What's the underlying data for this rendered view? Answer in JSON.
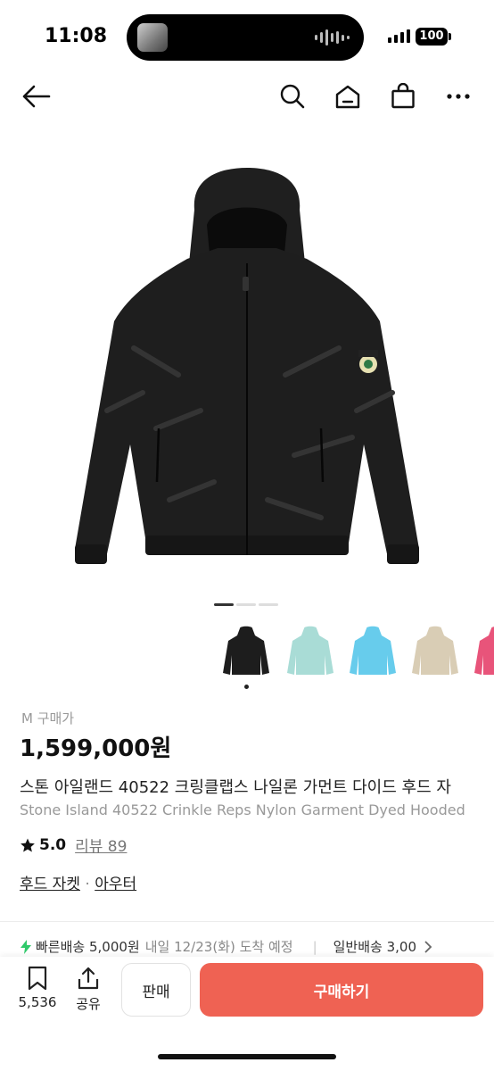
{
  "status_bar": {
    "time": "11:08",
    "battery": "100"
  },
  "product": {
    "size_label": "M 구매가",
    "price": "1,599,000원",
    "title_ko": "스톤 아일랜드 40522 크링클랩스 나일론 가먼트 다이드 후드 자",
    "title_en": "Stone Island 40522 Crinkle Reps Nylon Garment Dyed Hooded",
    "rating": "5.0",
    "review_label": "리뷰 89",
    "categories": [
      "후드 자켓",
      "아우터"
    ],
    "category_sep": "·"
  },
  "colors": {
    "black": "#1d1d1d",
    "mint": "#a9dcd6",
    "sky": "#67ccec",
    "beige": "#d9cdb5",
    "pink": "#e8547a",
    "accent": "#ef6253"
  },
  "shipping": {
    "fast_label": "빠른배송 5,000원",
    "fast_eta": "내일 12/23(화) 도착 예정",
    "normal_label": "일반배송 3,00"
  },
  "bottom_bar": {
    "bookmark_count": "5,536",
    "share_label": "공유",
    "sell_label": "판매",
    "buy_label": "구매하기"
  },
  "icons": [
    "back-arrow-icon",
    "search-icon",
    "home-icon",
    "shopping-bag-icon",
    "more-icon",
    "star-icon",
    "bolt-icon",
    "bookmark-icon",
    "share-icon",
    "chevron-right-icon"
  ]
}
